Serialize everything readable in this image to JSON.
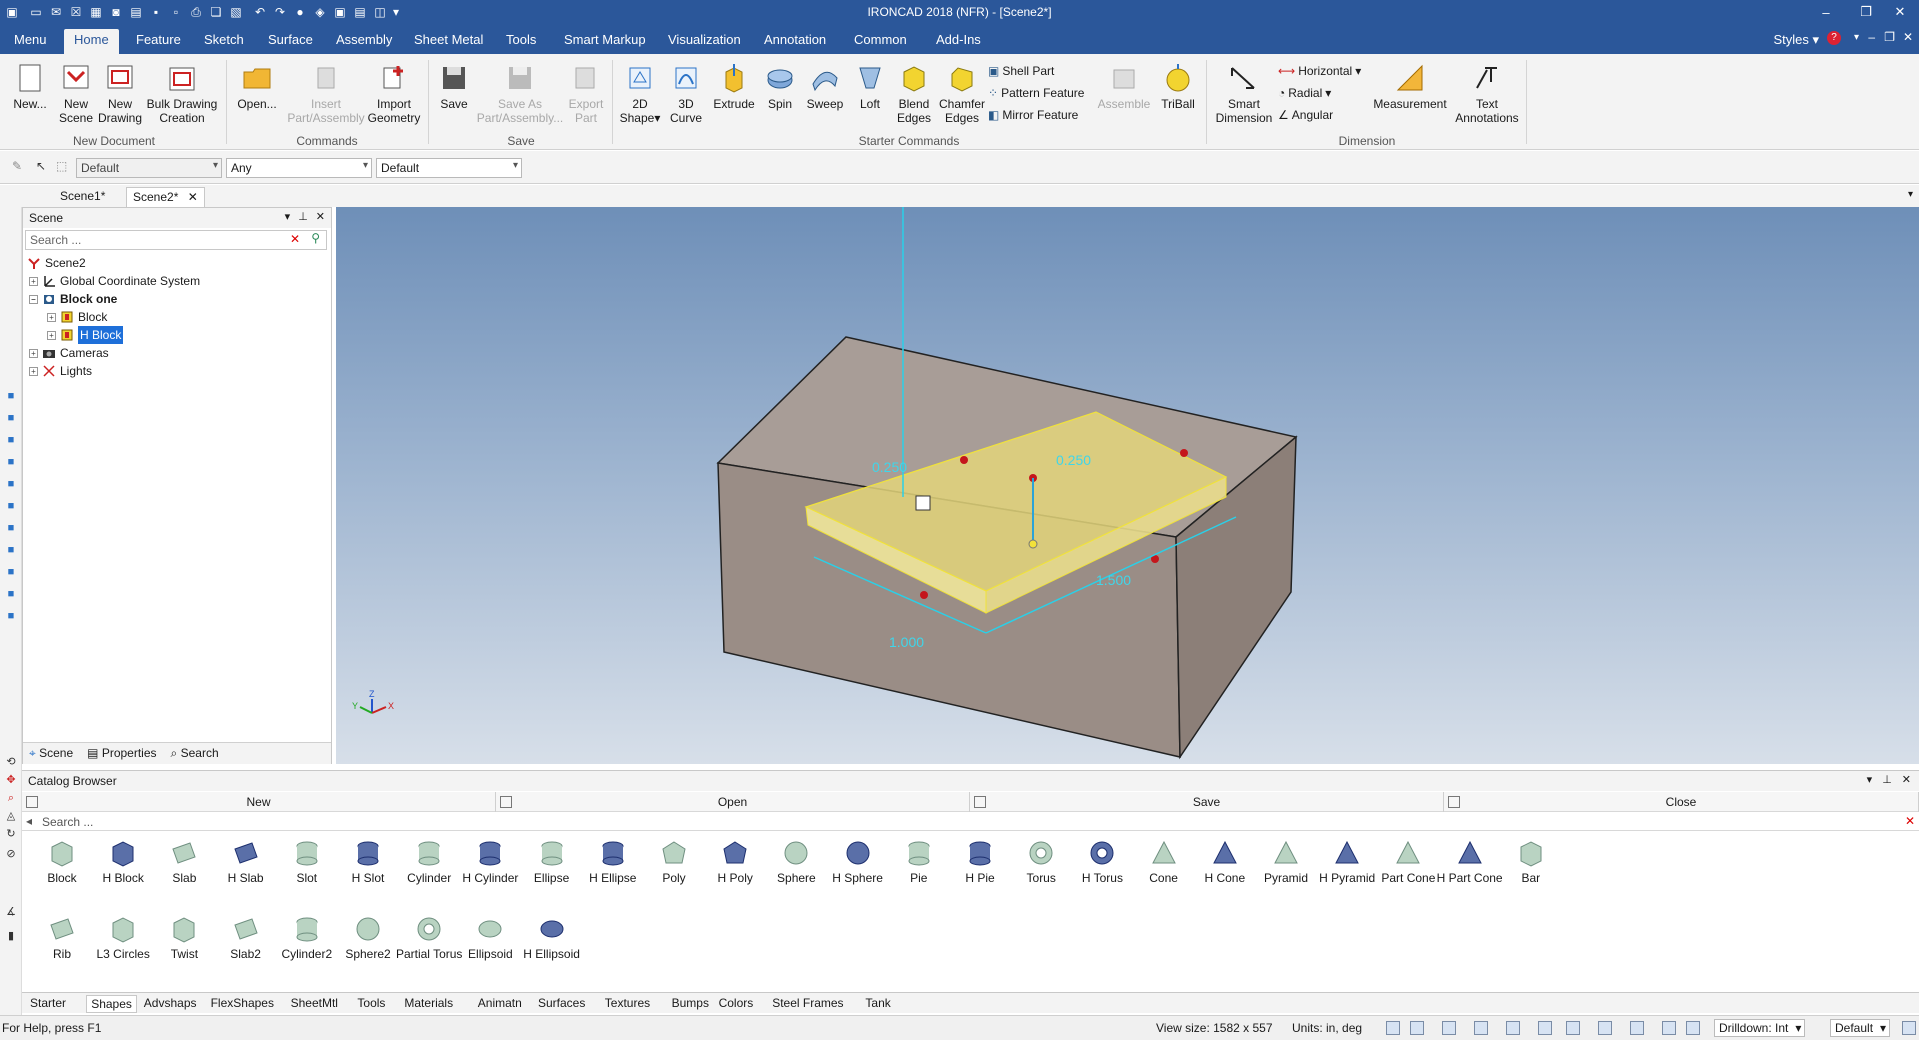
{
  "window": {
    "title": "IRONCAD 2018 (NFR) - [Scene2*]",
    "controls": {
      "minimize": "–",
      "restore": "❐",
      "close": "✕"
    }
  },
  "ribbon_tabs": [
    "Menu",
    "Home",
    "Feature",
    "Sketch",
    "Surface",
    "Assembly",
    "Sheet Metal",
    "Tools",
    "Smart Markup",
    "Visualization",
    "Annotation",
    "Common",
    "Add-Ins"
  ],
  "styles_label": "Styles",
  "ribbon": {
    "new_document": {
      "label": "New Document",
      "new": "New...",
      "new_scene": [
        "New",
        "Scene"
      ],
      "new_drawing": [
        "New",
        "Drawing"
      ],
      "bulk": [
        "Bulk Drawing",
        "Creation"
      ]
    },
    "commands": {
      "label": "Commands",
      "open": "Open...",
      "insert": [
        "Insert",
        "Part/Assembly"
      ],
      "import": [
        "Import",
        "Geometry"
      ]
    },
    "save": {
      "label": "Save",
      "save": "Save",
      "save_as": [
        "Save As",
        "Part/Assembly..."
      ],
      "export": [
        "Export",
        "Part"
      ]
    },
    "starter": {
      "label": "Starter Commands",
      "shape2d": [
        "2D",
        "Shape"
      ],
      "curve3d": [
        "3D",
        "Curve"
      ],
      "extrude": "Extrude",
      "spin": "Spin",
      "sweep": "Sweep",
      "loft": "Loft",
      "blend": [
        "Blend",
        "Edges"
      ],
      "chamfer": [
        "Chamfer",
        "Edges"
      ],
      "shell": "Shell Part",
      "pattern": "Pattern Feature",
      "mirror": "Mirror Feature",
      "assemble": "Assemble",
      "triball": "TriBall"
    },
    "dimension": {
      "label": "Dimension",
      "smart": [
        "Smart",
        "Dimension"
      ],
      "horizontal": "Horizontal",
      "radial": "Radial",
      "angular": "Angular",
      "measurement": "Measurement",
      "text": [
        "Text",
        "Annotations"
      ]
    }
  },
  "toolbar": {
    "combo1": "Default",
    "combo2": "Any",
    "combo3": "Default"
  },
  "doc_tabs": [
    "Scene1*",
    "Scene2*"
  ],
  "scene_panel": {
    "title": "Scene",
    "search_placeholder": "Search ...",
    "tree": [
      {
        "label": "Scene2",
        "level": 0
      },
      {
        "label": "Global Coordinate System",
        "level": 1
      },
      {
        "label": "Block one",
        "level": 1,
        "bold": true
      },
      {
        "label": "Block",
        "level": 2
      },
      {
        "label": "H Block",
        "level": 2,
        "selected": true
      },
      {
        "label": "Cameras",
        "level": 1
      },
      {
        "label": "Lights",
        "level": 1
      }
    ],
    "footer_tabs": [
      "Scene",
      "Properties",
      "Search"
    ]
  },
  "viewport": {
    "dimensions": {
      "width": "1.000",
      "length": "1.500",
      "depth": "0.250",
      "depth_left": "0.250"
    },
    "axes": {
      "x": "X",
      "y": "Y",
      "z": "Z"
    }
  },
  "catalog": {
    "title": "Catalog Browser",
    "actions": [
      "New",
      "Open",
      "Save",
      "Close"
    ],
    "search_placeholder": "Search ...",
    "shapes_row1": [
      "Block",
      "H Block",
      "Slab",
      "H Slab",
      "Slot",
      "H Slot",
      "Cylinder",
      "H Cylinder",
      "Ellipse",
      "H Ellipse",
      "Poly",
      "H Poly",
      "Sphere",
      "H Sphere",
      "Pie",
      "H Pie",
      "Torus",
      "H Torus",
      "Cone",
      "H Cone",
      "Pyramid",
      "H Pyramid",
      "Part Cone",
      "H Part Cone",
      "Bar"
    ],
    "shapes_row2": [
      "Rib",
      "L3 Circles",
      "Twist",
      "Slab2",
      "Cylinder2",
      "Sphere2",
      "Partial Torus",
      "Ellipsoid",
      "H Ellipsoid"
    ],
    "tabs": [
      "Starter",
      "Shapes",
      "Advshaps",
      "FlexShapes",
      "SheetMtl",
      "Tools",
      "Materials",
      "Animatn",
      "Surfaces",
      "Textures",
      "Bumps",
      "Colors",
      "Steel Frames",
      "Tank"
    ],
    "active_tab": "Shapes"
  },
  "status": {
    "help": "For Help, press F1",
    "view_size": "View size: 1582 x  557",
    "units": "Units: in, deg",
    "drilldown": "Drilldown: Int",
    "default": "Default"
  }
}
